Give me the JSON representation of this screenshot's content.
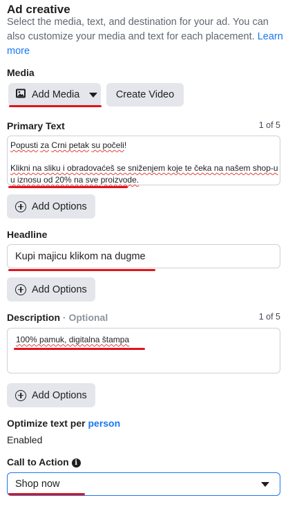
{
  "header": {
    "title": "Ad creative",
    "description": "Select the media, text, and destination for your ad. You can also customize your media and text for each placement.",
    "learn_more": "Learn more"
  },
  "media": {
    "label": "Media",
    "add_media": "Add Media",
    "create_video": "Create Video"
  },
  "primary_text": {
    "label": "Primary Text",
    "counter": "1 of 5",
    "line1": {
      "a": "Popusti",
      "b": " ",
      "c": "za",
      "d": " ",
      "e": "Crni petak",
      "f": " ",
      "g": "su počeli",
      "h": "!"
    },
    "line2": "Klikni na sliku i obradovaćeš se sniženjem koje te čeka na našem shop-u",
    "line3": "u iznosu od 20% na sve proizvode."
  },
  "add_options_label": "Add Options",
  "headline": {
    "label": "Headline",
    "value": "Kupi majicu klikom na dugme"
  },
  "description": {
    "label": "Description",
    "optional": " · Optional",
    "counter": "1 of 5",
    "value": "100% pamuk, digitalna štampa"
  },
  "optimize": {
    "label": "Optimize text per",
    "link": "person",
    "status": "Enabled"
  },
  "cta": {
    "label": "Call to Action",
    "info": "i",
    "value": "Shop now"
  },
  "colors": {
    "annotation_red": "#e1121a",
    "link_blue": "#1877f2",
    "button_gray": "#e4e6eb",
    "selected_border": "#1877f2"
  },
  "icons": {
    "media": "image-icon",
    "dropdown": "chevron-down-icon",
    "add": "plus-circle-icon",
    "info": "info-icon"
  }
}
